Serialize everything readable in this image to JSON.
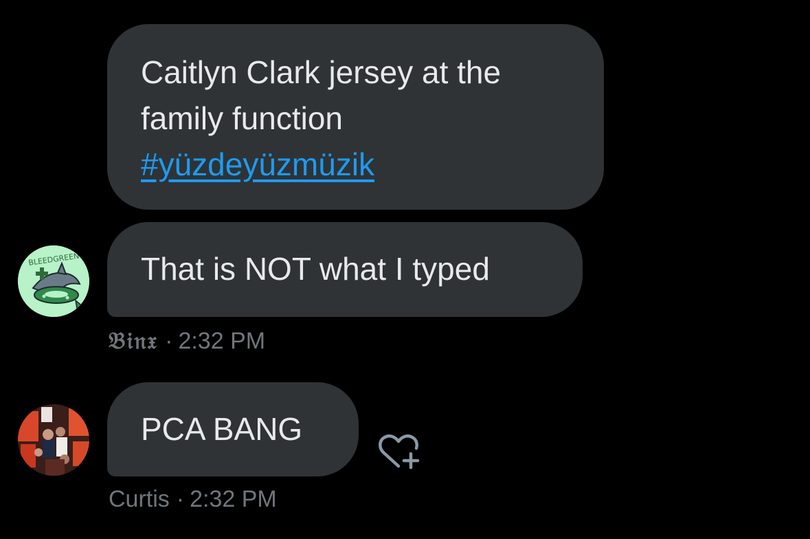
{
  "messages": [
    {
      "text_line1": "Caitlyn Clark jersey at the",
      "text_line2": "family function",
      "hashtag": "#yüzdeyüzmüzik"
    },
    {
      "text": "That is NOT what I typed",
      "sender": "𝔅𝔦𝔫𝔵",
      "time": "2:32 PM",
      "separator": "·",
      "avatar_lettering": "BLEEDGREEN"
    },
    {
      "text": "PCA BANG",
      "sender": "Curtis",
      "time": "2:32 PM",
      "separator": "·"
    }
  ],
  "actions": {
    "react_icon": "heart-plus-icon"
  },
  "colors": {
    "background": "#000000",
    "bubble": "#2f3336",
    "text": "#e7e9ea",
    "meta": "#71767b",
    "link": "#1d9bf0"
  }
}
